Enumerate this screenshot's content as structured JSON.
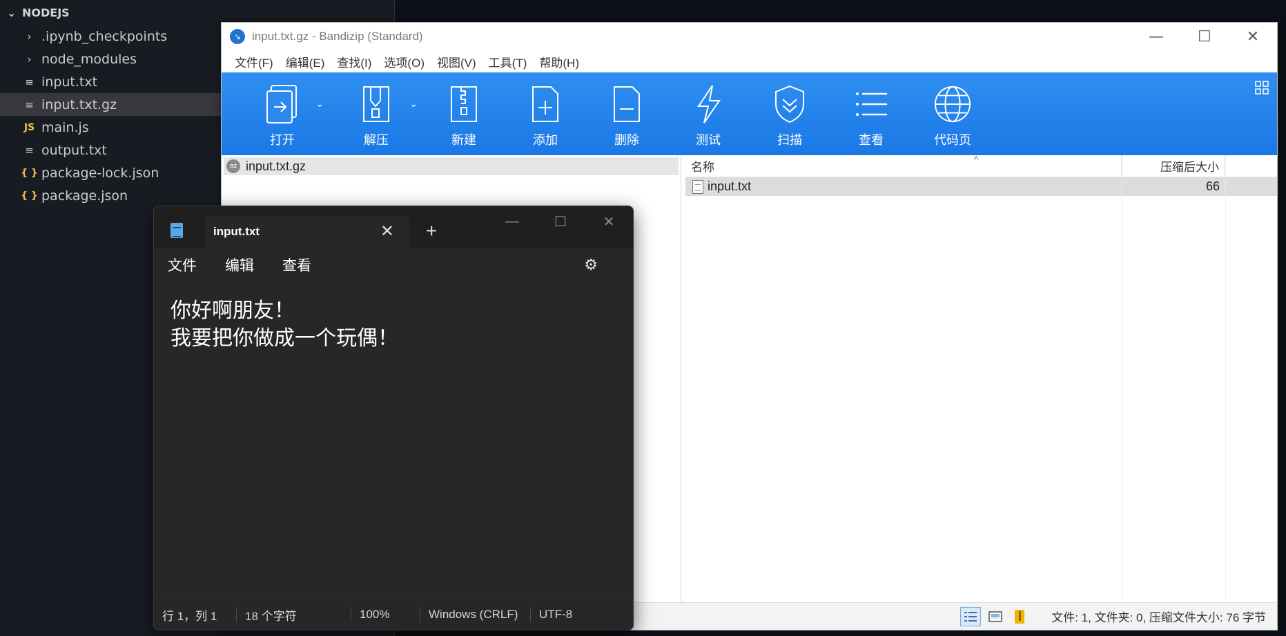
{
  "explorer": {
    "root_label": "NODEJS",
    "items": [
      {
        "label": ".ipynb_checkpoints",
        "kind": "folder"
      },
      {
        "label": "node_modules",
        "kind": "folder"
      },
      {
        "label": "input.txt",
        "kind": "file"
      },
      {
        "label": "input.txt.gz",
        "kind": "file"
      },
      {
        "label": "main.js",
        "kind": "js"
      },
      {
        "label": "output.txt",
        "kind": "file"
      },
      {
        "label": "package-lock.json",
        "kind": "json"
      },
      {
        "label": "package.json",
        "kind": "json"
      }
    ],
    "js_icon_text": "JS",
    "json_icon_text": "{ }"
  },
  "bandizip": {
    "title": "input.txt.gz - Bandizip (Standard)",
    "menu": [
      "文件(F)",
      "编辑(E)",
      "查找(I)",
      "选项(O)",
      "视图(V)",
      "工具(T)",
      "帮助(H)"
    ],
    "toolbar": {
      "open": "打开",
      "extract": "解压",
      "new": "新建",
      "add": "添加",
      "delete": "删除",
      "test": "测试",
      "scan": "扫描",
      "view": "查看",
      "codepage": "代码页"
    },
    "tree_node": "input.txt.gz",
    "gz_badge": "GZ",
    "columns": {
      "name": "名称",
      "compressed_size": "压缩后大小"
    },
    "files": [
      {
        "name": "input.txt",
        "size": "66"
      }
    ],
    "status_text": "文件: 1, 文件夹: 0, 压缩文件大小: 76 字节"
  },
  "notepad": {
    "tab_title": "input.txt",
    "menu": {
      "file": "文件",
      "edit": "编辑",
      "view": "查看"
    },
    "content_lines": [
      "你好啊朋友！",
      "我要把你做成一个玩偶！"
    ],
    "status": {
      "position": "行 1，列 1",
      "char_count": "18 个字符",
      "zoom": "100%",
      "line_ending": "Windows (CRLF)",
      "encoding": "UTF-8"
    }
  },
  "colors": {
    "bandizip_toolbar": "#1a78e6",
    "notepad_bg": "#272727",
    "explorer_bg": "#181c22",
    "selected_row": "#37373d"
  }
}
